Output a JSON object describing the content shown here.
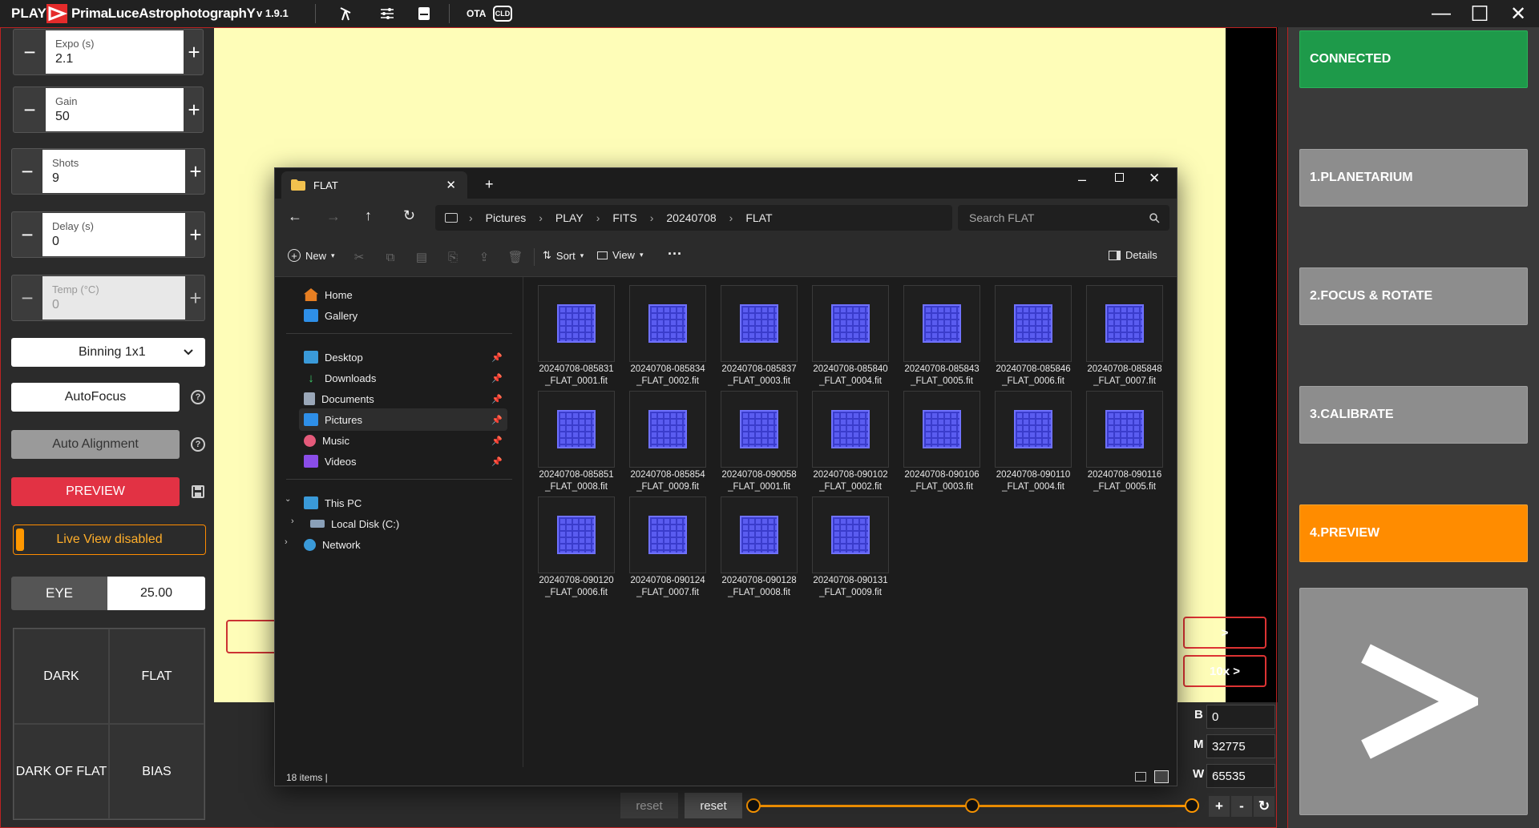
{
  "titlebar": {
    "play": "PLAY",
    "brand": "PrimaLuceAstrophotographY",
    "version": "v 1.9.1",
    "ota": "OTA",
    "cld": "CLD",
    "icons": [
      "telescope-icon",
      "sliders-icon",
      "storage-icon"
    ],
    "minimize": "—",
    "maximize": "☐",
    "close": "✕"
  },
  "controls": {
    "expo": {
      "label": "Expo (s)",
      "value": "2.1"
    },
    "gain": {
      "label": "Gain",
      "value": "50"
    },
    "shots": {
      "label": "Shots",
      "value": "9"
    },
    "delay": {
      "label": "Delay (s)",
      "value": "0"
    },
    "temp": {
      "label": "Temp (°C)",
      "value": "0"
    },
    "minus": "−",
    "plus": "+",
    "binning": "Binning 1x1",
    "autofocus": "AutoFocus",
    "autoalign": "Auto Alignment",
    "preview": "PREVIEW",
    "liveview": "Live View disabled",
    "eye_label": "EYE",
    "eye_value": "25.00",
    "frames": [
      "DARK",
      "FLAT",
      "DARK OF FLAT",
      "BIAS"
    ]
  },
  "right": {
    "connected": "CONNECTED",
    "steps": [
      "1.PLANETARIUM",
      "2.FOCUS & ROTATE",
      "3.CALIBRATE",
      "4.PREVIEW"
    ],
    "next": ">",
    "colors": {
      "connected": "#1e9a4a",
      "active": "#ff8c00",
      "idle": "#8d8d8d"
    }
  },
  "view": {
    "step1": ">",
    "step10": "10x >",
    "b_label": "B",
    "b_value": "0",
    "m_label": "M",
    "m_value": "32775",
    "w_label": "W",
    "w_value": "65535",
    "reset1": "reset",
    "reset2": "reset",
    "plus": "+",
    "minus": "-",
    "refresh": "↻"
  },
  "explorer": {
    "tab": "FLAT",
    "newtab": "+",
    "crumbs": [
      "Pictures",
      "PLAY",
      "FITS",
      "20240708",
      "FLAT"
    ],
    "search_placeholder": "Search FLAT",
    "tools": {
      "new": "New",
      "sort": "Sort",
      "view": "View",
      "more": "···",
      "details": "Details"
    },
    "sidebar": {
      "home": "Home",
      "gallery": "Gallery",
      "desktop": "Desktop",
      "downloads": "Downloads",
      "documents": "Documents",
      "pictures": "Pictures",
      "music": "Music",
      "videos": "Videos",
      "thispc": "This PC",
      "localdisk": "Local Disk (C:)",
      "network": "Network"
    },
    "files": [
      [
        "20240708-085831",
        "_FLAT_0001.fit"
      ],
      [
        "20240708-085834",
        "_FLAT_0002.fit"
      ],
      [
        "20240708-085837",
        "_FLAT_0003.fit"
      ],
      [
        "20240708-085840",
        "_FLAT_0004.fit"
      ],
      [
        "20240708-085843",
        "_FLAT_0005.fit"
      ],
      [
        "20240708-085846",
        "_FLAT_0006.fit"
      ],
      [
        "20240708-085848",
        "_FLAT_0007.fit"
      ],
      [
        "20240708-085851",
        "_FLAT_0008.fit"
      ],
      [
        "20240708-085854",
        "_FLAT_0009.fit"
      ],
      [
        "20240708-090058",
        "_FLAT_0001.fit"
      ],
      [
        "20240708-090102",
        "_FLAT_0002.fit"
      ],
      [
        "20240708-090106",
        "_FLAT_0003.fit"
      ],
      [
        "20240708-090110",
        "_FLAT_0004.fit"
      ],
      [
        "20240708-090116",
        "_FLAT_0005.fit"
      ],
      [
        "20240708-090120",
        "_FLAT_0006.fit"
      ],
      [
        "20240708-090124",
        "_FLAT_0007.fit"
      ],
      [
        "20240708-090128",
        "_FLAT_0008.fit"
      ],
      [
        "20240708-090131",
        "_FLAT_0009.fit"
      ]
    ],
    "status": "18 items  |"
  }
}
